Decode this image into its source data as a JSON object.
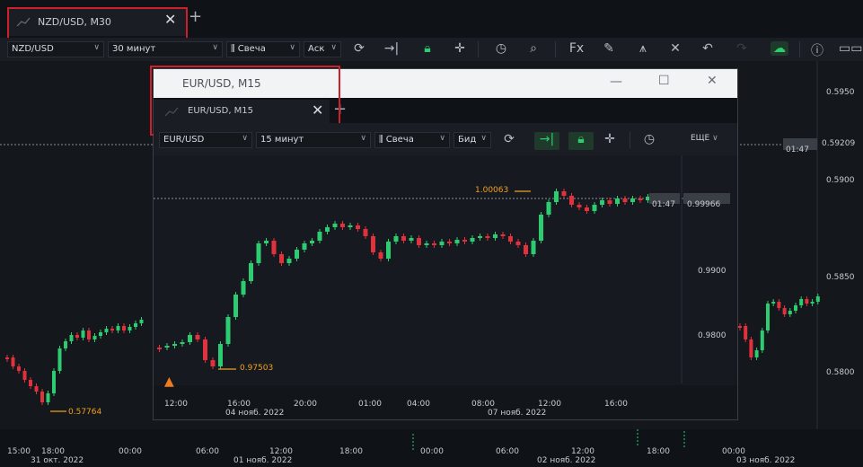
{
  "main": {
    "tab_title": "NZD/USD, M30",
    "symbol": "NZD/USD",
    "timeframe": "30 минут",
    "chart_type": "Свеча",
    "price_side": "Аск",
    "price_labels": [
      "0.5950",
      "0.5900",
      "0.5850",
      "0.5800"
    ],
    "current_time_tag": "01:47",
    "current_price_tag": "0.59209",
    "low_marker": "0.57764",
    "time_labels": [
      {
        "t": "15:00",
        "d": ""
      },
      {
        "t": "18:00",
        "d": "31 окт. 2022"
      },
      {
        "t": "00:00",
        "d": ""
      },
      {
        "t": "06:00",
        "d": ""
      },
      {
        "t": "12:00",
        "d": "01 нояб. 2022"
      },
      {
        "t": "18:00",
        "d": ""
      },
      {
        "t": "00:00",
        "d": ""
      },
      {
        "t": "06:00",
        "d": ""
      },
      {
        "t": "12:00",
        "d": "02 нояб. 2022"
      },
      {
        "t": "18:00",
        "d": ""
      },
      {
        "t": "00:00",
        "d": "03 нояб. 2022"
      }
    ]
  },
  "float": {
    "window_title": "EUR/USD, M15",
    "tab_title": "EUR/USD, M15",
    "symbol": "EUR/USD",
    "timeframe": "15 минут",
    "chart_type": "Свеча",
    "price_side": "Бид",
    "more_label": "ЕЩЕ",
    "price_labels": [
      "0.9900",
      "0.9800"
    ],
    "current_time_tag": "01:47",
    "current_price_tag": "0.99966",
    "high_marker": "1.00063",
    "low_marker": "0.97503",
    "time_labels": [
      {
        "t": "12:00",
        "d": ""
      },
      {
        "t": "16:00",
        "d": "04 нояб. 2022"
      },
      {
        "t": "20:00",
        "d": ""
      },
      {
        "t": "01:00",
        "d": ""
      },
      {
        "t": "04:00",
        "d": ""
      },
      {
        "t": "08:00",
        "d": ""
      },
      {
        "t": "12:00",
        "d": "07 нояб. 2022"
      },
      {
        "t": "16:00",
        "d": ""
      }
    ]
  },
  "colors": {
    "up": "#2ecc71",
    "down": "#e0323c",
    "marker": "#f0a020",
    "highlight": "#d01e2a"
  }
}
